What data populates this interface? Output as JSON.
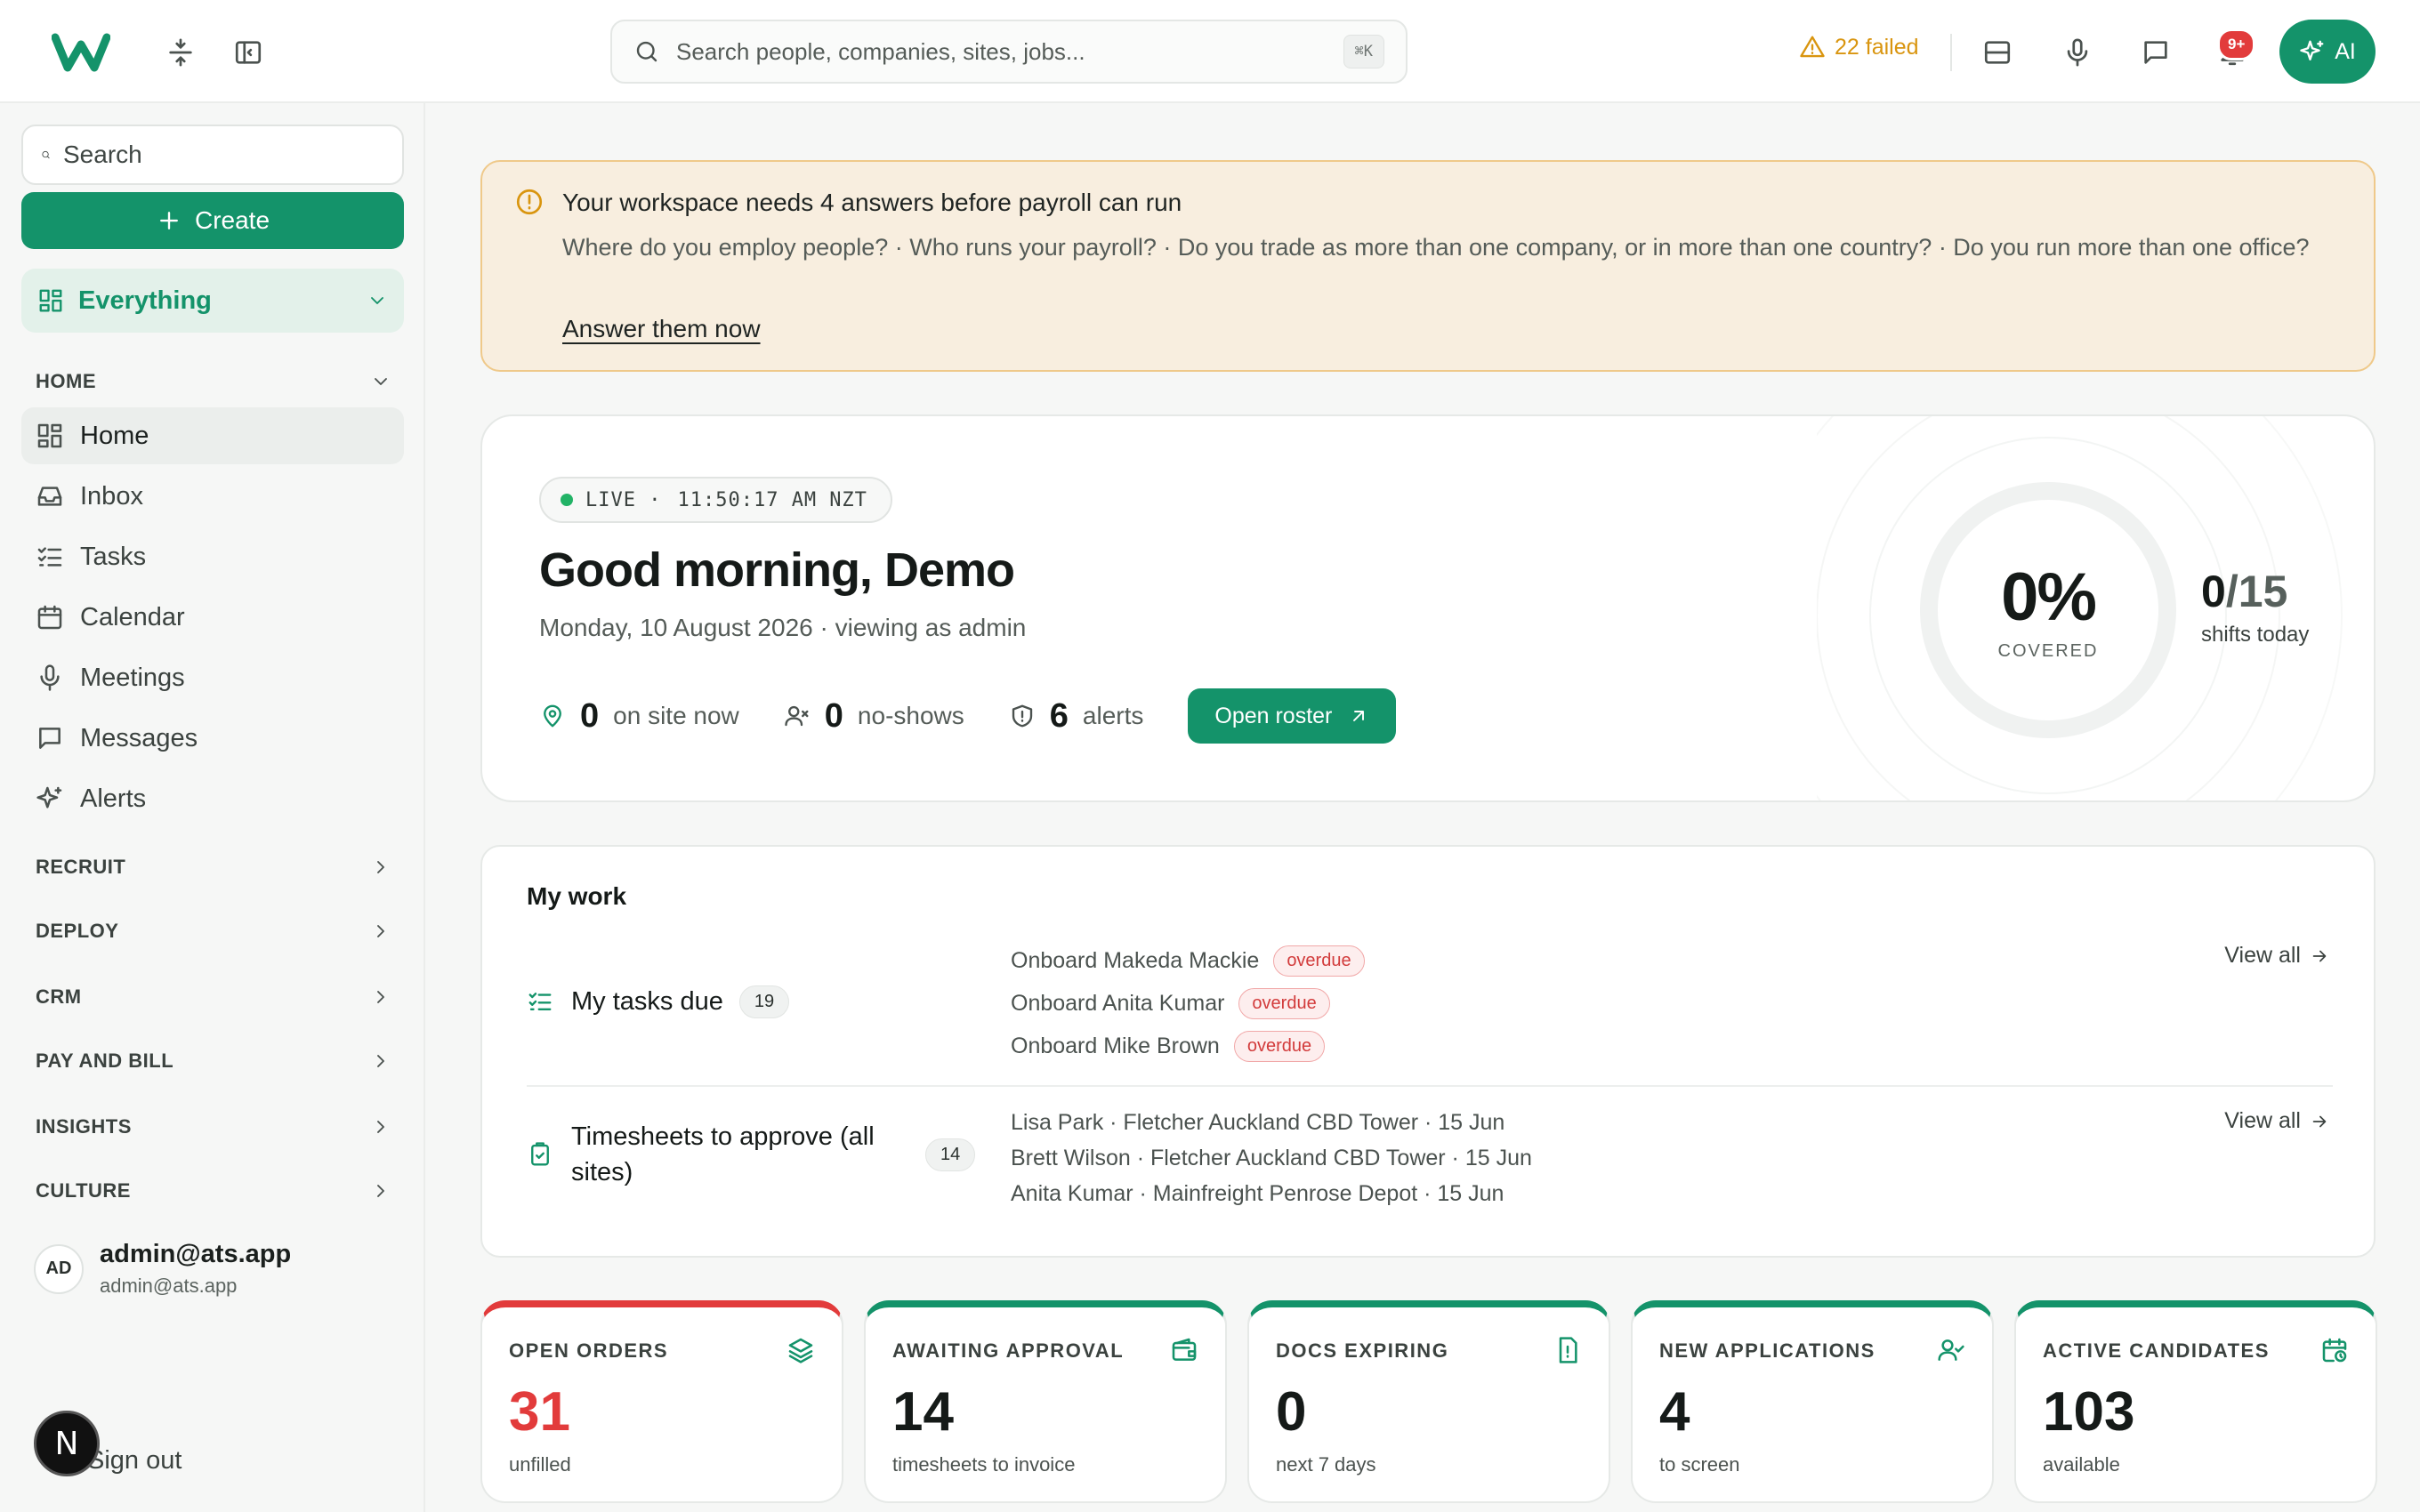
{
  "header": {
    "search_placeholder": "Search people, companies, sites, jobs...",
    "search_shortcut": "⌘K",
    "failed_label": "22 failed",
    "notifications_badge": "9+",
    "ai_label": "AI"
  },
  "sidebar": {
    "search_placeholder": "Search",
    "create_label": "Create",
    "workspace_label": "Everything",
    "home_section": "HOME",
    "home_items": [
      {
        "label": "Home",
        "icon": "dashboard-icon"
      },
      {
        "label": "Inbox",
        "icon": "inbox-icon"
      },
      {
        "label": "Tasks",
        "icon": "checklist-icon"
      },
      {
        "label": "Calendar",
        "icon": "calendar-icon"
      },
      {
        "label": "Meetings",
        "icon": "microphone-icon"
      },
      {
        "label": "Messages",
        "icon": "message-icon"
      },
      {
        "label": "Alerts",
        "icon": "sparkle-icon"
      }
    ],
    "sections": [
      "RECRUIT",
      "DEPLOY",
      "CRM",
      "PAY AND BILL",
      "INSIGHTS",
      "CULTURE"
    ],
    "user": {
      "initials": "AD",
      "name": "admin@ats.app",
      "email": "admin@ats.app"
    },
    "sign_out_label": "Sign out",
    "dev_badge": "N"
  },
  "banner": {
    "title": "Your workspace needs 4 answers before payroll can run",
    "text": "Where do you employ people? · Who runs your payroll? · Do you trade as more than one company, or in more than one country? · Do you run more than one office?",
    "link": "Answer them now"
  },
  "hero": {
    "live_label": "LIVE ·",
    "time": "11:50:17 AM",
    "timezone": "NZT",
    "greeting": "Good morning, Demo",
    "date_line": "Monday, 10 August 2026 · viewing as admin",
    "stats": [
      {
        "value": "0",
        "label": "on site now"
      },
      {
        "value": "0",
        "label": "no-shows"
      },
      {
        "value": "6",
        "label": "alerts"
      }
    ],
    "roster_button": "Open roster",
    "coverage_pct": "0%",
    "coverage_fraction": 0,
    "coverage_label": "COVERED",
    "shifts_done": "0",
    "shifts_total": "/15",
    "shifts_label": "shifts today"
  },
  "mywork": {
    "title": "My work",
    "tasks": {
      "label": "My tasks due",
      "count": "19",
      "items": [
        {
          "text": "Onboard Makeda Mackie",
          "badge": "overdue"
        },
        {
          "text": "Onboard Anita Kumar",
          "badge": "overdue"
        },
        {
          "text": "Onboard Mike Brown",
          "badge": "overdue"
        }
      ],
      "view_all": "View all"
    },
    "timesheets": {
      "label": "Timesheets to approve (all sites)",
      "count": "14",
      "items": [
        "Lisa Park · Fletcher Auckland CBD Tower · 15 Jun",
        "Brett Wilson · Fletcher Auckland CBD Tower · 15 Jun",
        "Anita Kumar · Mainfreight Penrose Depot · 15 Jun"
      ],
      "view_all": "View all"
    }
  },
  "kpis": [
    {
      "label": "OPEN ORDERS",
      "value": "31",
      "sub": "unfilled",
      "icon": "layers-icon",
      "accent": "#e23b3b"
    },
    {
      "label": "AWAITING APPROVAL",
      "value": "14",
      "sub": "timesheets to invoice",
      "icon": "wallet-icon",
      "accent": "#14936a"
    },
    {
      "label": "DOCS EXPIRING",
      "value": "0",
      "sub": "next 7 days",
      "icon": "file-alert-icon",
      "accent": "#14936a"
    },
    {
      "label": "NEW APPLICATIONS",
      "value": "4",
      "sub": "to screen",
      "icon": "user-check-icon",
      "accent": "#14936a"
    },
    {
      "label": "ACTIVE CANDIDATES",
      "value": "103",
      "sub": "available",
      "icon": "calendar-clock-icon",
      "accent": "#14936a"
    }
  ],
  "colors": {
    "brand": "#14936a",
    "warning": "#d9950f",
    "danger": "#e23b3b"
  }
}
